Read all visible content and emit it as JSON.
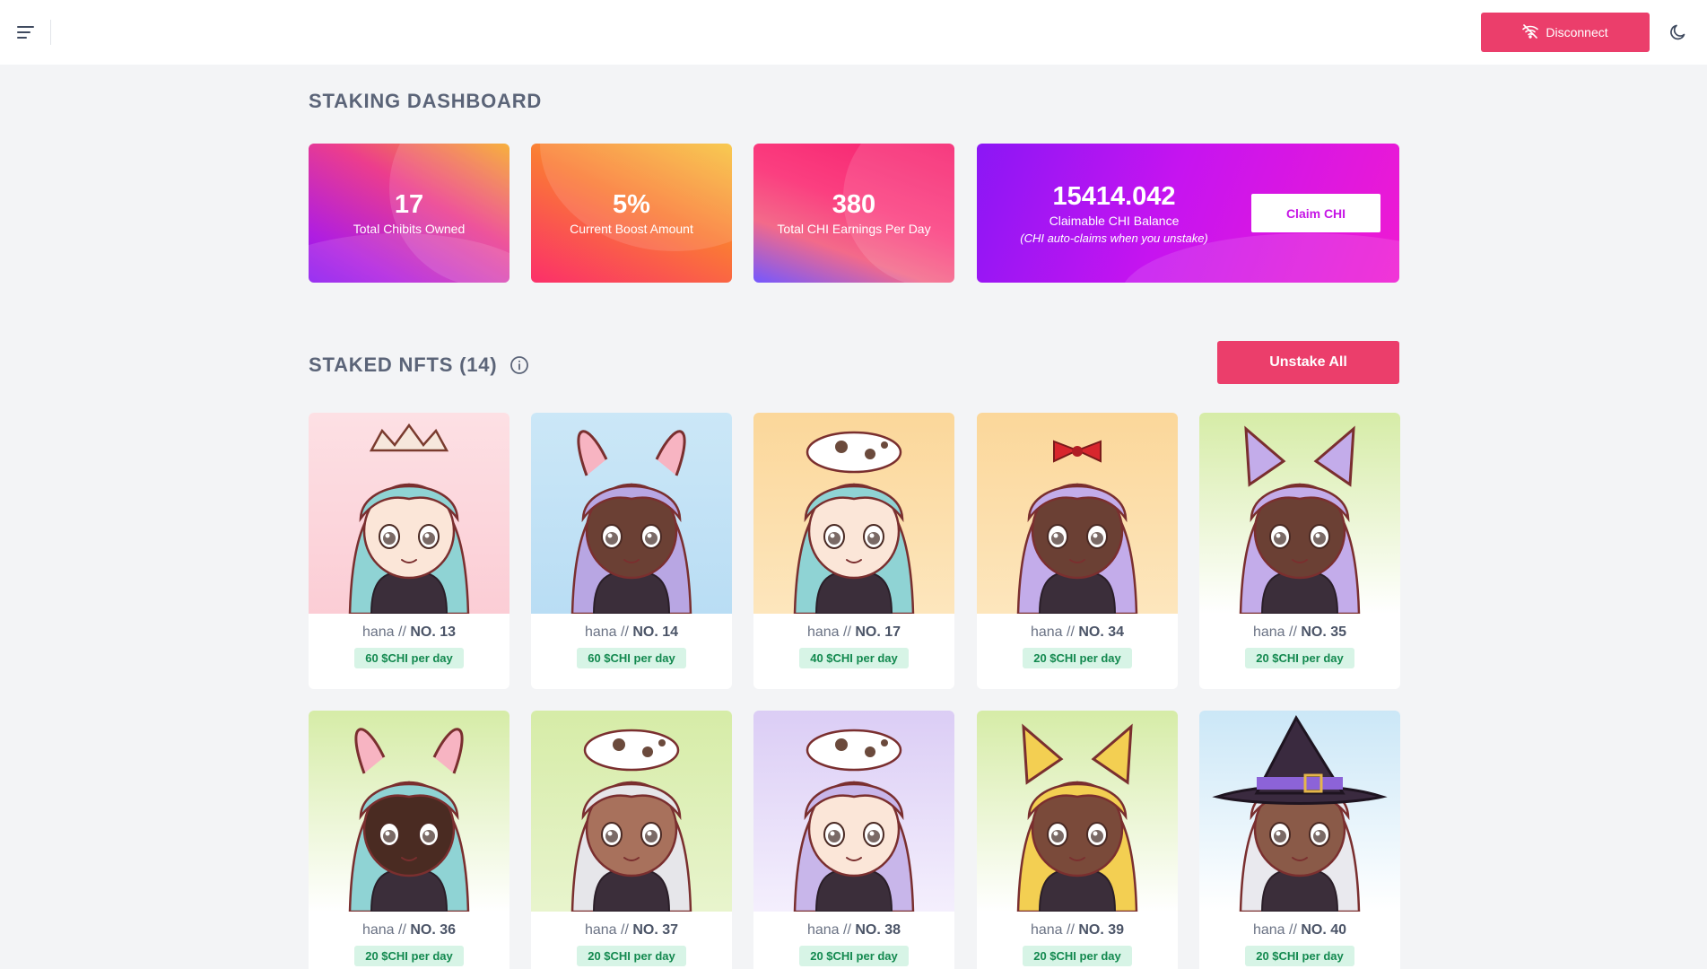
{
  "topbar": {
    "menu_icon": "menu-lines-icon",
    "disconnect_label": "Disconnect",
    "disconnect_icon": "wifi-off-icon",
    "theme_icon": "moon-icon"
  },
  "page_title": "STAKING DASHBOARD",
  "stats": [
    {
      "value": "17",
      "label": "Total Chibits Owned"
    },
    {
      "value": "5%",
      "label": "Current Boost Amount"
    },
    {
      "value": "380",
      "label": "Total CHI Earnings Per Day"
    }
  ],
  "claim": {
    "value": "15414.042",
    "label": "Claimable CHI Balance",
    "note": "(CHI auto-claims when you unstake)",
    "button_label": "Claim CHI"
  },
  "staked": {
    "title": "STAKED NFTS (14)",
    "info_icon": "info-circle-icon",
    "unstake_all_label": "Unstake All",
    "sep": "//",
    "items": [
      {
        "prefix": "hana",
        "number": "NO. 13",
        "rate": "60 $CHI per day",
        "bg": "#fde0e4",
        "bg2": "#fbcdd5",
        "hair": "#8fd3d4",
        "skin": "#fbe6d8",
        "accent": "crown"
      },
      {
        "prefix": "hana",
        "number": "NO. 14",
        "rate": "60 $CHI per day",
        "bg": "#cbe7f7",
        "bg2": "#b9ddf4",
        "hair": "#b8a6e3",
        "skin": "#6b4034",
        "accent": "bunny"
      },
      {
        "prefix": "hana",
        "number": "NO. 17",
        "rate": "40 $CHI per day",
        "bg": "#fbd79a",
        "bg2": "#fde6bd",
        "hair": "#8fd3d4",
        "skin": "#fbe6d8",
        "accent": "cat"
      },
      {
        "prefix": "hana",
        "number": "NO. 34",
        "rate": "20 $CHI per day",
        "bg": "#fbd79a",
        "bg2": "#fde6bd",
        "hair": "#c3acea",
        "skin": "#6b4034",
        "accent": "bow"
      },
      {
        "prefix": "hana",
        "number": "NO. 35",
        "rate": "20 $CHI per day",
        "bg": "#d6eca7",
        "bg2": "#ffffff",
        "hair": "#c3acea",
        "skin": "#6b4034",
        "accent": "catears"
      },
      {
        "prefix": "hana",
        "number": "NO. 36",
        "rate": "20 $CHI per day",
        "bg": "#d6eca7",
        "bg2": "#ffffff",
        "hair": "#8fd3d4",
        "skin": "#4a2b22",
        "accent": "bunny"
      },
      {
        "prefix": "hana",
        "number": "NO. 37",
        "rate": "20 $CHI per day",
        "bg": "#d6eca7",
        "bg2": "#e8f4cd",
        "hair": "#e6e6ea",
        "skin": "#a8715c",
        "accent": "cat"
      },
      {
        "prefix": "hana",
        "number": "NO. 38",
        "rate": "20 $CHI per day",
        "bg": "#dbcdf5",
        "bg2": "#f4effd",
        "hair": "#c8b6ea",
        "skin": "#fbe6d8",
        "accent": "cat"
      },
      {
        "prefix": "hana",
        "number": "NO. 39",
        "rate": "20 $CHI per day",
        "bg": "#d6eca7",
        "bg2": "#ffffff",
        "hair": "#f3cf52",
        "skin": "#7a4a3a",
        "accent": "catears"
      },
      {
        "prefix": "hana",
        "number": "NO. 40",
        "rate": "20 $CHI per day",
        "bg": "#cbe7f7",
        "bg2": "#ffffff",
        "hair": "#e9e9ee",
        "skin": "#8a5a48",
        "accent": "witch"
      }
    ]
  }
}
